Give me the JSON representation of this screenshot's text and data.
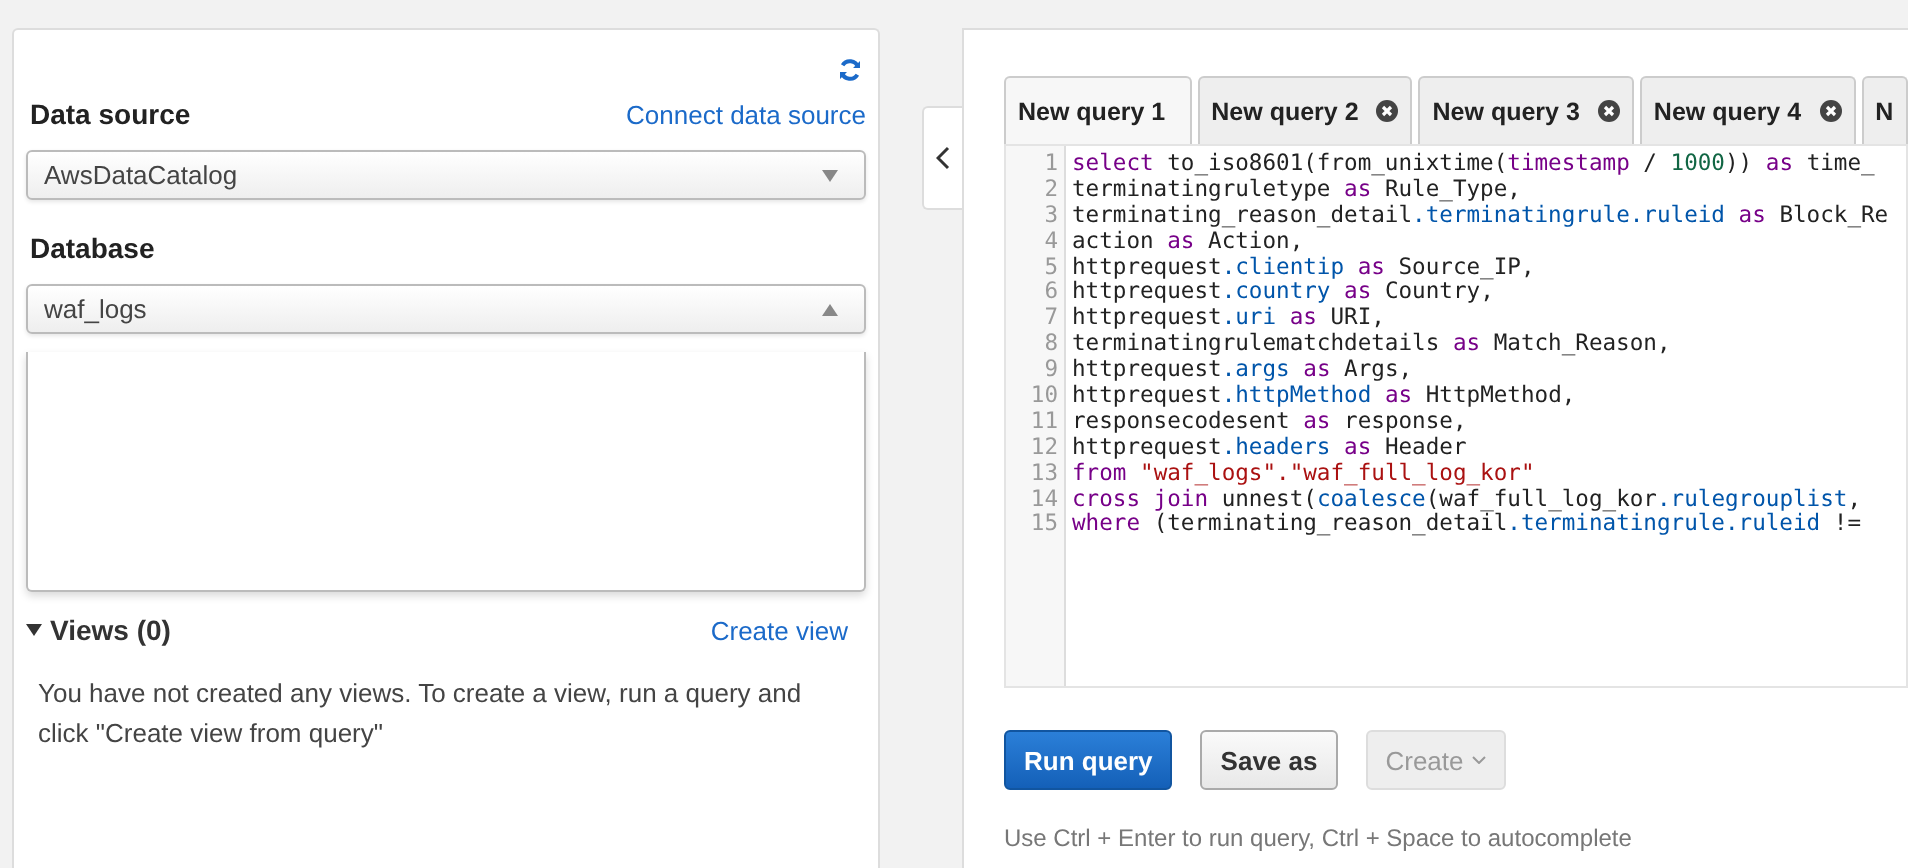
{
  "sidebar": {
    "data_source": {
      "label": "Data source",
      "link": "Connect data source",
      "value": "AwsDataCatalog",
      "expanded": false
    },
    "database": {
      "label": "Database",
      "value": "waf_logs",
      "expanded": true
    },
    "views": {
      "title": "Views (0)",
      "expanded": true,
      "link": "Create view",
      "message": "You have not created any views. To create a view, run a query and click \"Create view from query\""
    }
  },
  "tabs": [
    {
      "label": "New query 1",
      "selected": true,
      "closable": false
    },
    {
      "label": "New query 2",
      "selected": false,
      "closable": true
    },
    {
      "label": "New query 3",
      "selected": false,
      "closable": true
    },
    {
      "label": "New query 4",
      "selected": false,
      "closable": true
    },
    {
      "label": "N",
      "selected": false,
      "closable": false
    }
  ],
  "editor": {
    "lines": [
      {
        "number": "1",
        "tokens": [
          {
            "kind": "kw",
            "text": "select"
          },
          {
            "kind": "plain",
            "text": " to_iso8601(from_unixtime("
          },
          {
            "kind": "kw",
            "text": "timestamp"
          },
          {
            "kind": "plain",
            "text": " / "
          },
          {
            "kind": "num",
            "text": "1000"
          },
          {
            "kind": "plain",
            "text": ")) "
          },
          {
            "kind": "kw",
            "text": "as"
          },
          {
            "kind": "plain",
            "text": " time_"
          }
        ]
      },
      {
        "number": "2",
        "tokens": [
          {
            "kind": "plain",
            "text": "terminatingruletype "
          },
          {
            "kind": "kw",
            "text": "as"
          },
          {
            "kind": "plain",
            "text": " Rule_Type,"
          }
        ]
      },
      {
        "number": "3",
        "tokens": [
          {
            "kind": "plain",
            "text": "terminating_reason_detail"
          },
          {
            "kind": "prop",
            "text": ".terminatingrule.ruleid"
          },
          {
            "kind": "kw",
            "text": " as"
          },
          {
            "kind": "plain",
            "text": " Block_Re"
          }
        ]
      },
      {
        "number": "4",
        "tokens": [
          {
            "kind": "plain",
            "text": "action "
          },
          {
            "kind": "kw",
            "text": "as"
          },
          {
            "kind": "plain",
            "text": " Action,"
          }
        ]
      },
      {
        "number": "5",
        "tokens": [
          {
            "kind": "plain",
            "text": "httprequest"
          },
          {
            "kind": "prop",
            "text": ".clientip"
          },
          {
            "kind": "kw",
            "text": " as"
          },
          {
            "kind": "plain",
            "text": " Source_IP,"
          }
        ]
      },
      {
        "number": "6",
        "tokens": [
          {
            "kind": "plain",
            "text": "httprequest"
          },
          {
            "kind": "prop",
            "text": ".country"
          },
          {
            "kind": "kw",
            "text": " as"
          },
          {
            "kind": "plain",
            "text": " Country,"
          }
        ]
      },
      {
        "number": "7",
        "tokens": [
          {
            "kind": "plain",
            "text": "httprequest"
          },
          {
            "kind": "prop",
            "text": ".uri"
          },
          {
            "kind": "kw",
            "text": " as"
          },
          {
            "kind": "plain",
            "text": " URI,"
          }
        ]
      },
      {
        "number": "8",
        "tokens": [
          {
            "kind": "plain",
            "text": "terminatingrulematchdetails "
          },
          {
            "kind": "kw",
            "text": "as"
          },
          {
            "kind": "plain",
            "text": " Match_Reason,"
          }
        ]
      },
      {
        "number": "9",
        "tokens": [
          {
            "kind": "plain",
            "text": "httprequest"
          },
          {
            "kind": "prop",
            "text": ".args"
          },
          {
            "kind": "kw",
            "text": " as"
          },
          {
            "kind": "plain",
            "text": " Args,"
          }
        ]
      },
      {
        "number": "10",
        "tokens": [
          {
            "kind": "plain",
            "text": "httprequest"
          },
          {
            "kind": "prop",
            "text": ".httpMethod"
          },
          {
            "kind": "kw",
            "text": " as"
          },
          {
            "kind": "plain",
            "text": " HttpMethod,"
          }
        ]
      },
      {
        "number": "11",
        "tokens": [
          {
            "kind": "plain",
            "text": "responsecodesent "
          },
          {
            "kind": "kw",
            "text": "as"
          },
          {
            "kind": "plain",
            "text": " response,"
          }
        ]
      },
      {
        "number": "12",
        "tokens": [
          {
            "kind": "plain",
            "text": "httprequest"
          },
          {
            "kind": "prop",
            "text": ".headers"
          },
          {
            "kind": "kw",
            "text": " as"
          },
          {
            "kind": "plain",
            "text": " Header"
          }
        ]
      },
      {
        "number": "13",
        "tokens": [
          {
            "kind": "kw",
            "text": "from"
          },
          {
            "kind": "str",
            "text": " \"waf_logs\".\"waf_full_log_kor\""
          }
        ]
      },
      {
        "number": "14",
        "tokens": [
          {
            "kind": "kw",
            "text": "cross join"
          },
          {
            "kind": "plain",
            "text": " unnest("
          },
          {
            "kind": "prop",
            "text": "coalesce"
          },
          {
            "kind": "plain",
            "text": "(waf_full_log_kor"
          },
          {
            "kind": "prop",
            "text": ".rulegrouplist"
          },
          {
            "kind": "plain",
            "text": ","
          }
        ]
      },
      {
        "number": "15",
        "tokens": [
          {
            "kind": "kw",
            "text": "where"
          },
          {
            "kind": "plain",
            "text": " (terminating_reason_detail"
          },
          {
            "kind": "prop",
            "text": ".terminatingrule.ruleid"
          },
          {
            "kind": "plain",
            "text": " !="
          }
        ]
      }
    ]
  },
  "buttons": [
    {
      "kind": "primary",
      "label": "Run query",
      "disabled": false
    },
    {
      "kind": "default",
      "label": "Save as",
      "disabled": false
    },
    {
      "kind": "menu",
      "label": "Create",
      "disabled": true
    }
  ],
  "hint": "Use Ctrl + Enter to run query, Ctrl + Space to autocomplete"
}
